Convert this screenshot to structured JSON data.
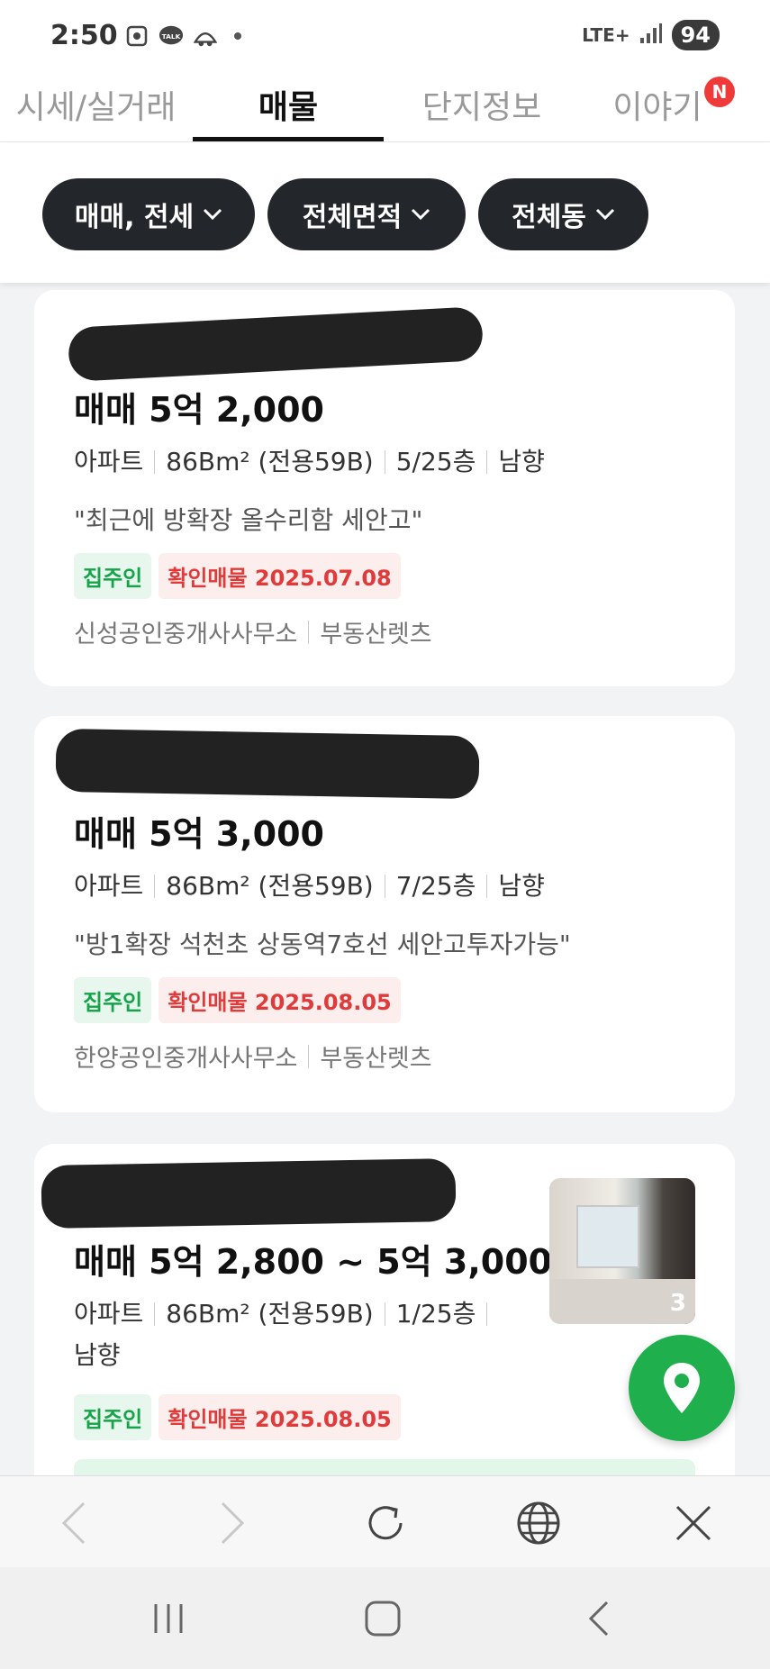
{
  "status_bar": {
    "time": "2:50",
    "network": "LTE+",
    "battery": "94"
  },
  "tabs": [
    {
      "label": "시세/실거래"
    },
    {
      "label": "매물"
    },
    {
      "label": "단지정보"
    },
    {
      "label": "이야기"
    }
  ],
  "new_badge": "N",
  "filters": [
    {
      "label": "매매, 전세"
    },
    {
      "label": "전체면적"
    },
    {
      "label": "전체동"
    }
  ],
  "listings": [
    {
      "price": "매매 5억 2,000",
      "type": "아파트",
      "area": "86Bm² (전용59B)",
      "floor": "5/25층",
      "direction": "남향",
      "description": "\"최근에 방확장 올수리함 세안고\"",
      "owner_tag": "집주인",
      "verified_tag": "확인매물 2025.07.08",
      "agency": "신성공인중개사사무소",
      "source": "부동산렛츠"
    },
    {
      "price": "매매 5억 3,000",
      "type": "아파트",
      "area": "86Bm² (전용59B)",
      "floor": "7/25층",
      "direction": "남향",
      "description": "\"방1확장 석천초 상동역7호선 세안고투자가능\"",
      "owner_tag": "집주인",
      "verified_tag": "확인매물 2025.08.05",
      "agency": "한양공인중개사사무소",
      "source": "부동산렛츠"
    },
    {
      "price": "매매 5억 2,800 ~ 5억 3,000",
      "type": "아파트",
      "area": "86Bm² (전용59B)",
      "floor": "1/25층",
      "direction": "남향",
      "owner_tag": "집주인",
      "verified_tag": "확인매물 2025.08.05",
      "photo_count": "3"
    }
  ],
  "icons": {
    "map_fab": "location-pin-icon",
    "browser": [
      "back-icon",
      "forward-icon",
      "refresh-icon",
      "globe-icon",
      "close-icon"
    ],
    "system_nav": [
      "recents-icon",
      "home-icon",
      "back-icon"
    ]
  },
  "colors": {
    "chip_bg": "#23262b",
    "owner_green": "#17a34a",
    "verified_red": "#e03b3b",
    "fab_green": "#1fb04d"
  }
}
